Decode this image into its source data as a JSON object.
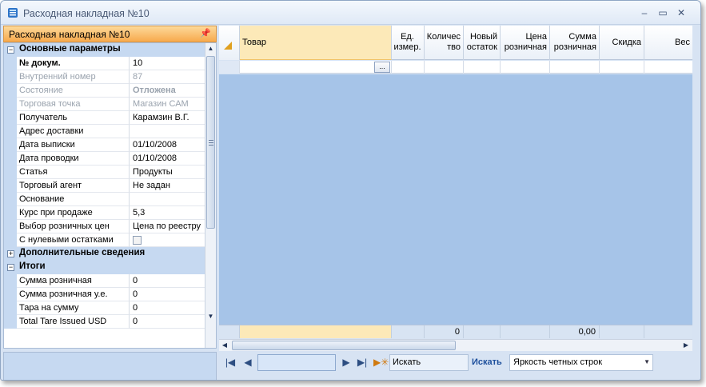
{
  "window": {
    "title": "Расходная накладная №10"
  },
  "panel": {
    "title": "Расходная накладная №10"
  },
  "categories": {
    "main": "Основные параметры",
    "extra": "Дополнительные сведения",
    "totals": "Итоги"
  },
  "main_props": [
    {
      "name": "№ докум.",
      "value": "10"
    },
    {
      "name": "Внутренний номер",
      "value": "87"
    },
    {
      "name": "Состояние",
      "value": "Отложена"
    },
    {
      "name": "Торговая точка",
      "value": "Магазин САМ"
    },
    {
      "name": "Получатель",
      "value": "Карамзин В.Г."
    },
    {
      "name": "Адрес доставки",
      "value": ""
    },
    {
      "name": "Дата выписки",
      "value": "01/10/2008"
    },
    {
      "name": "Дата проводки",
      "value": "01/10/2008"
    },
    {
      "name": "Статья",
      "value": "Продукты"
    },
    {
      "name": "Торговый агент",
      "value": "Не задан"
    },
    {
      "name": "Основание",
      "value": ""
    },
    {
      "name": "Курс при продаже",
      "value": "5,3"
    },
    {
      "name": "Выбор розничных цен",
      "value": "Цена по реестру"
    },
    {
      "name": "С нулевыми остатками",
      "value": ""
    }
  ],
  "totals_props": [
    {
      "name": "Сумма розничная",
      "value": "0"
    },
    {
      "name": "Сумма розничная у.е.",
      "value": "0"
    },
    {
      "name": "Тара на сумму",
      "value": "0"
    },
    {
      "name": "Total Tare Issued USD",
      "value": "0"
    }
  ],
  "columns": [
    {
      "l1": "Товар",
      "l2": ""
    },
    {
      "l1": "Ед.",
      "l2": "измер."
    },
    {
      "l1": "Количес",
      "l2": "тво"
    },
    {
      "l1": "Новый",
      "l2": "остаток"
    },
    {
      "l1": "Цена",
      "l2": "розничная"
    },
    {
      "l1": "Сумма",
      "l2": "розничная"
    },
    {
      "l1": "Скидка",
      "l2": ""
    },
    {
      "l1": "Вес",
      "l2": ""
    }
  ],
  "summary": {
    "qty_total": "0",
    "sum_total": "0,00"
  },
  "editor": {
    "ellipsis": "..."
  },
  "nav": {
    "search_placeholder": "Искать",
    "search_button": "Искать",
    "brightness_option": "Яркость четных строк"
  }
}
